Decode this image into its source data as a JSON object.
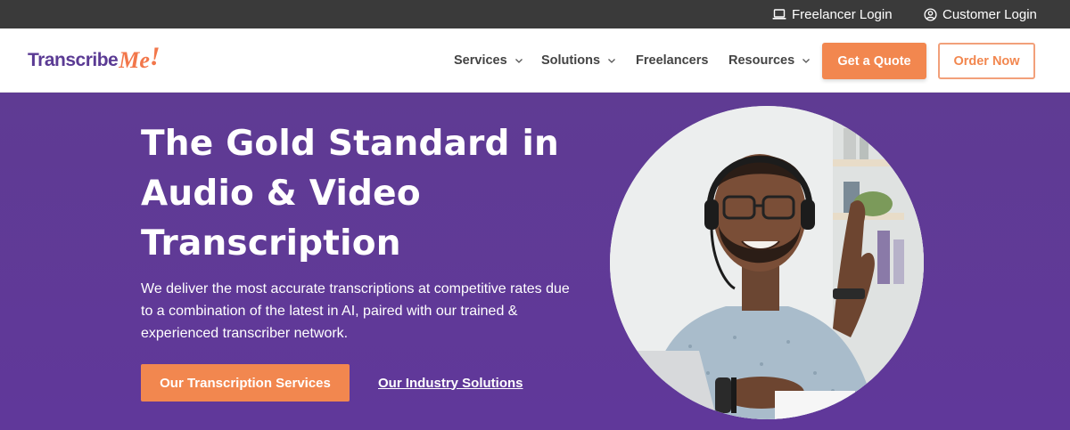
{
  "topbar": {
    "freelancer_login": "Freelancer Login",
    "freelancer_icon": "laptop-icon",
    "customer_login": "Customer Login",
    "customer_icon": "user-circle-icon"
  },
  "nav": {
    "logo_text": "Transcribe",
    "logo_me": "Me",
    "logo_bang": "!",
    "items": [
      {
        "label": "Services",
        "has_dropdown": true
      },
      {
        "label": "Solutions",
        "has_dropdown": true
      },
      {
        "label": "Freelancers",
        "has_dropdown": false
      },
      {
        "label": "Resources",
        "has_dropdown": true
      }
    ],
    "quote_button": "Get a Quote",
    "order_button": "Order Now"
  },
  "hero": {
    "title_line1": "The Gold Standard in",
    "title_line2": "Audio & Video",
    "title_line3": "Transcription",
    "subtitle": "We deliver the most accurate transcriptions at competitive rates due to a combination of the latest in AI, paired with our trained & experienced transcriber network.",
    "primary_button": "Our Transcription Services",
    "secondary_link": "Our Industry Solutions"
  },
  "colors": {
    "brand_purple": "#5f3b93",
    "accent_orange": "#f2874f",
    "topbar_bg": "#3a3a3a"
  }
}
